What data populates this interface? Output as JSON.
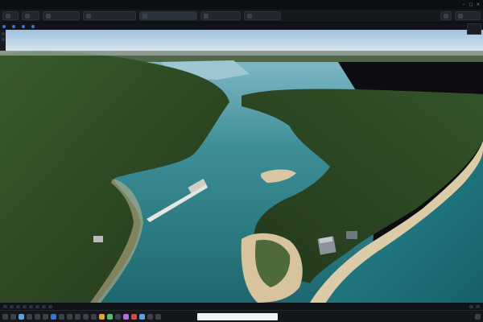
{
  "menubar": {
    "items": [
      "",
      "",
      "",
      "",
      "",
      "",
      "",
      "",
      "",
      "",
      "",
      ""
    ]
  },
  "toolbar": {
    "buttons": [
      "",
      "",
      "",
      "",
      "",
      "",
      ""
    ]
  },
  "strip": {
    "segments": [
      "",
      "",
      "",
      ""
    ]
  },
  "statusbar": {
    "label": ""
  },
  "taskbar": {
    "search_placeholder": "",
    "tray": ""
  },
  "colors": {
    "sky": "#cfe0ec",
    "forest": "#2f4a24",
    "water": "#1f6f78",
    "sand": "#d9c7a3"
  }
}
